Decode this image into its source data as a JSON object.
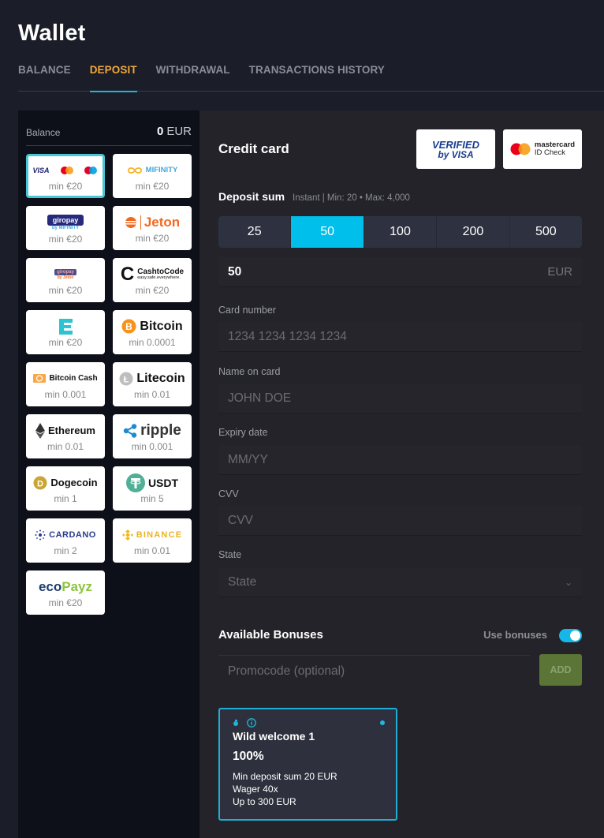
{
  "page": {
    "title": "Wallet"
  },
  "tabs": [
    {
      "label": "BALANCE",
      "active": false
    },
    {
      "label": "DEPOSIT",
      "active": true
    },
    {
      "label": "WITHDRAWAL",
      "active": false
    },
    {
      "label": "TRANSACTIONS HISTORY",
      "active": false
    }
  ],
  "balance": {
    "label": "Balance",
    "amount": "0",
    "currency": "EUR"
  },
  "methods": [
    {
      "id": "credit-card",
      "logo_text": "VISA",
      "min": "min €20",
      "selected": true
    },
    {
      "id": "mifinity",
      "logo_text": "MIFINITY",
      "min": "min €20"
    },
    {
      "id": "giropay-mifinity",
      "logo_text": "giropay",
      "logo_sub": "by MIFINITY",
      "min": "min €20"
    },
    {
      "id": "jeton",
      "logo_text": "Jeton",
      "min": "min €20"
    },
    {
      "id": "giropay-jeton",
      "logo_text": "giropay",
      "logo_sub": "by Jeton",
      "min": "min €20"
    },
    {
      "id": "cashtocode",
      "logo_text": "CashtoCode",
      "logo_sub": "easy.safe.everywhere.",
      "min": "min €20"
    },
    {
      "id": "ezeewallet",
      "logo_text": "",
      "min": "min €20"
    },
    {
      "id": "bitcoin",
      "logo_text": "Bitcoin",
      "min": "min 0.0001"
    },
    {
      "id": "bitcoin-cash",
      "logo_text": "Bitcoin Cash",
      "min": "min 0.001"
    },
    {
      "id": "litecoin",
      "logo_text": "Litecoin",
      "min": "min 0.01"
    },
    {
      "id": "ethereum",
      "logo_text": "Ethereum",
      "min": "min 0.01"
    },
    {
      "id": "ripple",
      "logo_text": "ripple",
      "min": "min 0.001"
    },
    {
      "id": "dogecoin",
      "logo_text": "Dogecoin",
      "min": "min 1"
    },
    {
      "id": "usdt",
      "logo_text": "USDT",
      "min": "min 5"
    },
    {
      "id": "cardano",
      "logo_text": "CARDANO",
      "min": "min 2"
    },
    {
      "id": "binance",
      "logo_text": "BINANCE",
      "min": "min 0.01"
    },
    {
      "id": "ecopayz",
      "logo_text": "eco",
      "logo_text2": "Payz",
      "min": "min €20"
    }
  ],
  "form": {
    "title": "Credit card",
    "verified_visa": {
      "line1": "VERIFIED",
      "line2": "by VISA"
    },
    "mastercard_id": {
      "line1": "mastercard",
      "line2": "ID Check"
    },
    "deposit_sum": {
      "label": "Deposit sum",
      "hint": "Instant | Min: 20 • Max: 4,000",
      "presets": [
        "25",
        "50",
        "100",
        "200",
        "500"
      ],
      "selected": "50",
      "value": "50",
      "currency": "EUR"
    },
    "card_number": {
      "label": "Card number",
      "placeholder": "1234 1234 1234 1234"
    },
    "name_on_card": {
      "label": "Name on card",
      "placeholder": "JOHN DOE"
    },
    "expiry": {
      "label": "Expiry date",
      "placeholder": "MM/YY"
    },
    "cvv": {
      "label": "CVV",
      "placeholder": "CVV"
    },
    "state": {
      "label": "State",
      "placeholder": "State"
    }
  },
  "bonuses": {
    "title": "Available Bonuses",
    "use_label": "Use bonuses",
    "use_enabled": true,
    "promo_placeholder": "Promocode (optional)",
    "add_label": "ADD",
    "card": {
      "name": "Wild welcome 1",
      "percent": "100%",
      "lines": [
        "Min deposit sum 20 EUR",
        "Wager 40x",
        "Up to 300 EUR"
      ]
    }
  },
  "colors": {
    "accent": "#00bfea",
    "tab_active": "#f0a83a",
    "add_button": "#5a7536"
  }
}
